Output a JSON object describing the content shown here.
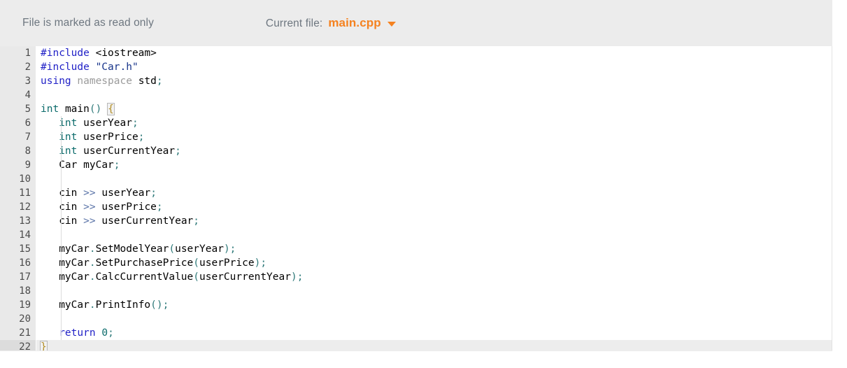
{
  "header": {
    "readonly_note": "File is marked as read only",
    "current_file_label": "Current file:",
    "file_name": "main.cpp",
    "caret_icon": "chevron-down-icon",
    "accent_color": "#f58220",
    "muted_text_color": "#6e7780",
    "background_color": "#ececec"
  },
  "editor": {
    "language": "cpp",
    "read_only": true,
    "active_line": 22,
    "first_visible_line": 1,
    "last_visible_line": 22,
    "total_lines": 22,
    "gutter_background": "#e9e9e9",
    "code_background": "#ffffff",
    "lines": [
      {
        "n": "1",
        "tokens": [
          {
            "t": "#include",
            "c": "t-pre"
          },
          {
            "t": " ",
            "c": "t-plain"
          },
          {
            "t": "<iostream>",
            "c": "t-plain"
          }
        ]
      },
      {
        "n": "2",
        "tokens": [
          {
            "t": "#include",
            "c": "t-pre"
          },
          {
            "t": " ",
            "c": "t-plain"
          },
          {
            "t": "\"Car.h\"",
            "c": "t-str"
          }
        ]
      },
      {
        "n": "3",
        "tokens": [
          {
            "t": "using",
            "c": "t-kw"
          },
          {
            "t": " ",
            "c": "t-plain"
          },
          {
            "t": "namespace",
            "c": "t-ns"
          },
          {
            "t": " ",
            "c": "t-plain"
          },
          {
            "t": "std",
            "c": "t-plain"
          },
          {
            "t": ";",
            "c": "t-punct"
          }
        ]
      },
      {
        "n": "4",
        "tokens": []
      },
      {
        "n": "5",
        "tokens": [
          {
            "t": "int",
            "c": "t-type"
          },
          {
            "t": " ",
            "c": "t-plain"
          },
          {
            "t": "main",
            "c": "t-plain"
          },
          {
            "t": "()",
            "c": "t-punct"
          },
          {
            "t": " ",
            "c": "t-plain"
          },
          {
            "t": "{",
            "c": "brace-match"
          }
        ]
      },
      {
        "n": "6",
        "indent": true,
        "tokens": [
          {
            "t": "   ",
            "c": "t-plain"
          },
          {
            "t": "int",
            "c": "t-type"
          },
          {
            "t": " ",
            "c": "t-plain"
          },
          {
            "t": "userYear",
            "c": "t-plain"
          },
          {
            "t": ";",
            "c": "t-punct"
          }
        ]
      },
      {
        "n": "7",
        "indent": true,
        "tokens": [
          {
            "t": "   ",
            "c": "t-plain"
          },
          {
            "t": "int",
            "c": "t-type"
          },
          {
            "t": " ",
            "c": "t-plain"
          },
          {
            "t": "userPrice",
            "c": "t-plain"
          },
          {
            "t": ";",
            "c": "t-punct"
          }
        ]
      },
      {
        "n": "8",
        "indent": true,
        "tokens": [
          {
            "t": "   ",
            "c": "t-plain"
          },
          {
            "t": "int",
            "c": "t-type"
          },
          {
            "t": " ",
            "c": "t-plain"
          },
          {
            "t": "userCurrentYear",
            "c": "t-plain"
          },
          {
            "t": ";",
            "c": "t-punct"
          }
        ]
      },
      {
        "n": "9",
        "indent": true,
        "tokens": [
          {
            "t": "   ",
            "c": "t-plain"
          },
          {
            "t": "Car",
            "c": "t-plain"
          },
          {
            "t": " ",
            "c": "t-plain"
          },
          {
            "t": "myCar",
            "c": "t-plain"
          },
          {
            "t": ";",
            "c": "t-punct"
          }
        ]
      },
      {
        "n": "10",
        "indent": true,
        "tokens": []
      },
      {
        "n": "11",
        "indent": true,
        "tokens": [
          {
            "t": "   ",
            "c": "t-plain"
          },
          {
            "t": "cin",
            "c": "t-plain"
          },
          {
            "t": " ",
            "c": "t-plain"
          },
          {
            "t": ">>",
            "c": "t-op"
          },
          {
            "t": " ",
            "c": "t-plain"
          },
          {
            "t": "userYear",
            "c": "t-plain"
          },
          {
            "t": ";",
            "c": "t-punct"
          }
        ]
      },
      {
        "n": "12",
        "indent": true,
        "tokens": [
          {
            "t": "   ",
            "c": "t-plain"
          },
          {
            "t": "cin",
            "c": "t-plain"
          },
          {
            "t": " ",
            "c": "t-plain"
          },
          {
            "t": ">>",
            "c": "t-op"
          },
          {
            "t": " ",
            "c": "t-plain"
          },
          {
            "t": "userPrice",
            "c": "t-plain"
          },
          {
            "t": ";",
            "c": "t-punct"
          }
        ]
      },
      {
        "n": "13",
        "indent": true,
        "tokens": [
          {
            "t": "   ",
            "c": "t-plain"
          },
          {
            "t": "cin",
            "c": "t-plain"
          },
          {
            "t": " ",
            "c": "t-plain"
          },
          {
            "t": ">>",
            "c": "t-op"
          },
          {
            "t": " ",
            "c": "t-plain"
          },
          {
            "t": "userCurrentYear",
            "c": "t-plain"
          },
          {
            "t": ";",
            "c": "t-punct"
          }
        ]
      },
      {
        "n": "14",
        "indent": true,
        "tokens": []
      },
      {
        "n": "15",
        "indent": true,
        "tokens": [
          {
            "t": "   ",
            "c": "t-plain"
          },
          {
            "t": "myCar",
            "c": "t-plain"
          },
          {
            "t": ".",
            "c": "t-punct"
          },
          {
            "t": "SetModelYear",
            "c": "t-plain"
          },
          {
            "t": "(",
            "c": "t-punct"
          },
          {
            "t": "userYear",
            "c": "t-plain"
          },
          {
            "t": ")",
            "c": "t-punct"
          },
          {
            "t": ";",
            "c": "t-punct"
          }
        ]
      },
      {
        "n": "16",
        "indent": true,
        "tokens": [
          {
            "t": "   ",
            "c": "t-plain"
          },
          {
            "t": "myCar",
            "c": "t-plain"
          },
          {
            "t": ".",
            "c": "t-punct"
          },
          {
            "t": "SetPurchasePrice",
            "c": "t-plain"
          },
          {
            "t": "(",
            "c": "t-punct"
          },
          {
            "t": "userPrice",
            "c": "t-plain"
          },
          {
            "t": ")",
            "c": "t-punct"
          },
          {
            "t": ";",
            "c": "t-punct"
          }
        ]
      },
      {
        "n": "17",
        "indent": true,
        "tokens": [
          {
            "t": "   ",
            "c": "t-plain"
          },
          {
            "t": "myCar",
            "c": "t-plain"
          },
          {
            "t": ".",
            "c": "t-punct"
          },
          {
            "t": "CalcCurrentValue",
            "c": "t-plain"
          },
          {
            "t": "(",
            "c": "t-punct"
          },
          {
            "t": "userCurrentYear",
            "c": "t-plain"
          },
          {
            "t": ")",
            "c": "t-punct"
          },
          {
            "t": ";",
            "c": "t-punct"
          }
        ]
      },
      {
        "n": "18",
        "indent": true,
        "tokens": []
      },
      {
        "n": "19",
        "indent": true,
        "tokens": [
          {
            "t": "   ",
            "c": "t-plain"
          },
          {
            "t": "myCar",
            "c": "t-plain"
          },
          {
            "t": ".",
            "c": "t-punct"
          },
          {
            "t": "PrintInfo",
            "c": "t-plain"
          },
          {
            "t": "()",
            "c": "t-punct"
          },
          {
            "t": ";",
            "c": "t-punct"
          }
        ]
      },
      {
        "n": "20",
        "indent": true,
        "tokens": []
      },
      {
        "n": "21",
        "indent": true,
        "tokens": [
          {
            "t": "   ",
            "c": "t-plain"
          },
          {
            "t": "return",
            "c": "t-kw"
          },
          {
            "t": " ",
            "c": "t-plain"
          },
          {
            "t": "0",
            "c": "t-num"
          },
          {
            "t": ";",
            "c": "t-punct"
          }
        ]
      },
      {
        "n": "22",
        "active": true,
        "tokens": [
          {
            "t": "}",
            "c": "brace-match"
          }
        ]
      }
    ]
  },
  "scrollbar": {
    "up_icon": "triangle-up-icon",
    "down_icon": "triangle-down-icon",
    "thumb_color": "#bdbdbd",
    "track_color": "#f2f2f2"
  },
  "resize_grip": {
    "icon": "resize-grip-icon"
  }
}
